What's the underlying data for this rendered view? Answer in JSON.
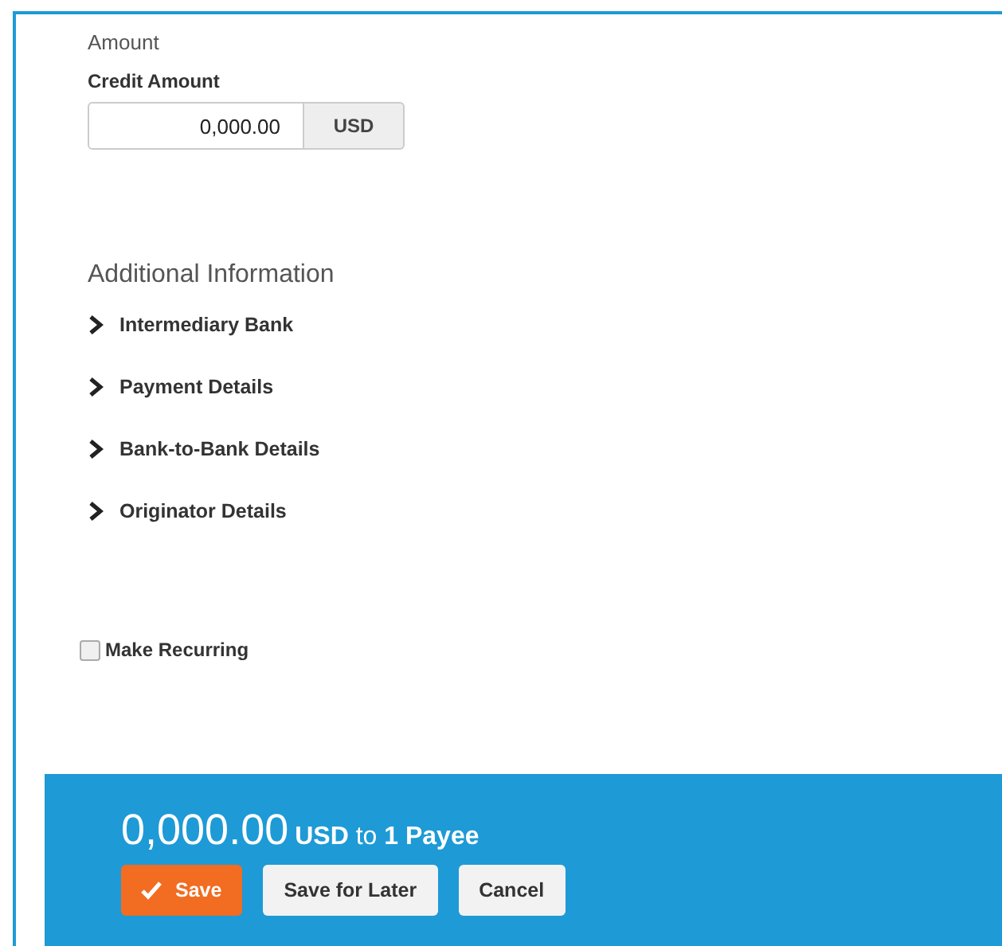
{
  "amount_section": {
    "title": "Amount",
    "field_label": "Credit Amount",
    "value": "0,000.00",
    "currency": "USD"
  },
  "additional_information": {
    "title": "Additional Information",
    "items": [
      {
        "label": "Intermediary Bank",
        "expanded": false
      },
      {
        "label": "Payment Details",
        "expanded": false
      },
      {
        "label": "Bank-to-Bank Details",
        "expanded": false
      },
      {
        "label": "Originator Details",
        "expanded": false
      }
    ]
  },
  "make_recurring": {
    "label": "Make Recurring",
    "checked": false
  },
  "summary": {
    "amount": "0,000.00",
    "detail": "**USD** to **1 Payee**"
  },
  "buttons": [
    {
      "label": "Save",
      "kind": "primary"
    },
    {
      "label": "Save for Later",
      "kind": "secondary"
    },
    {
      "label": "Cancel",
      "kind": "secondary"
    }
  ]
}
